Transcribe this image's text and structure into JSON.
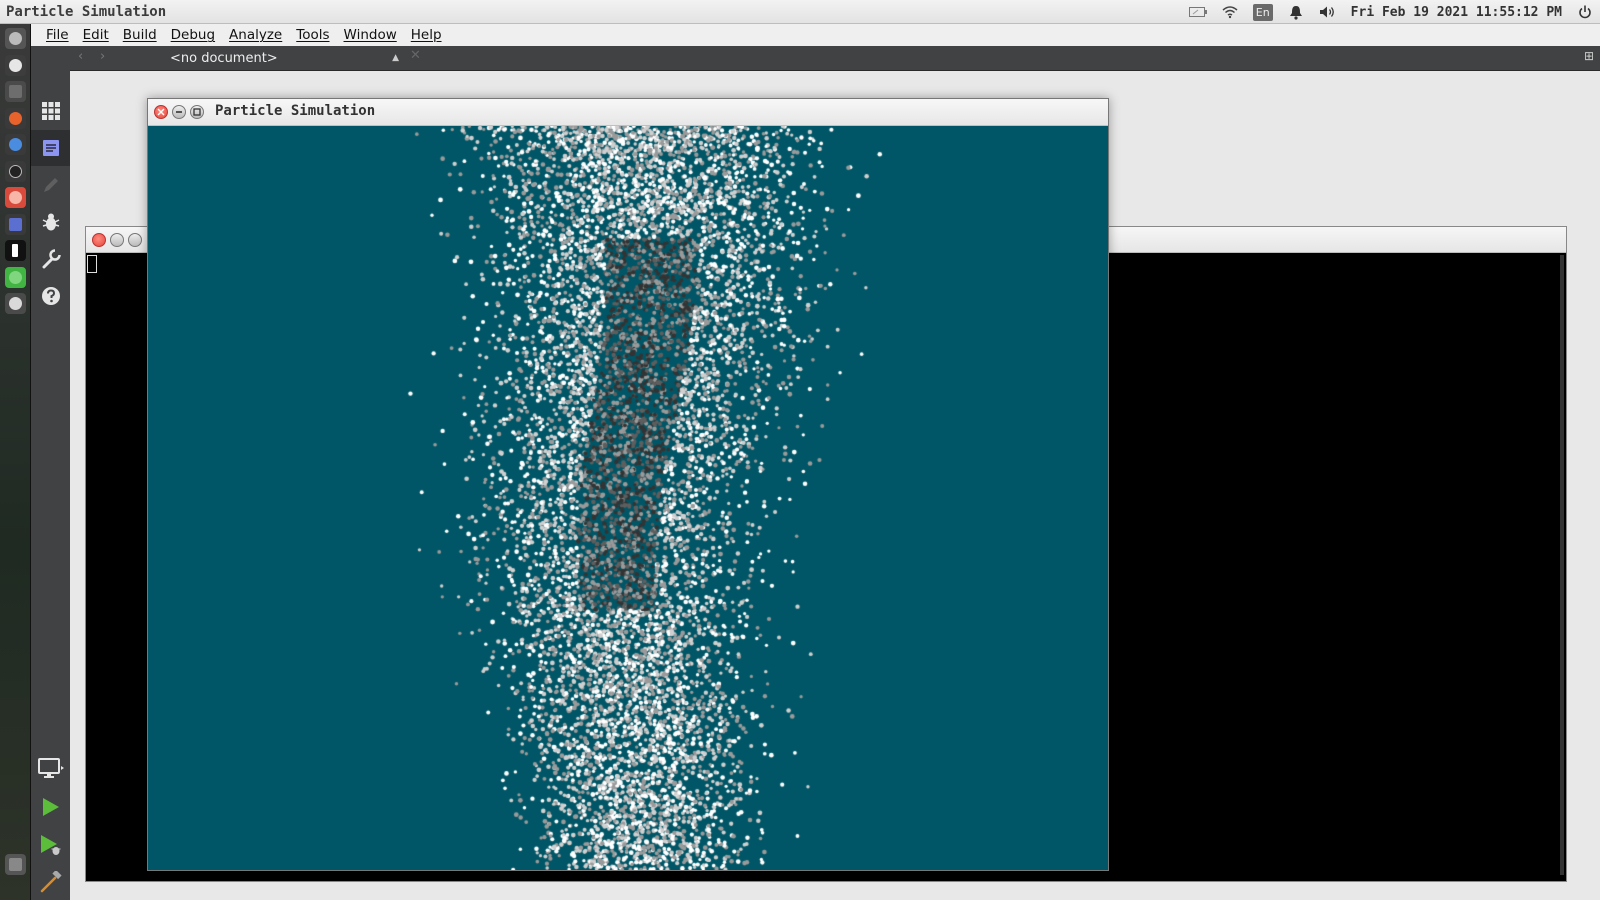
{
  "system_panel": {
    "app_title": "Particle Simulation",
    "language": "En",
    "clock": "Fri Feb 19 2021  11:55:12 PM",
    "icons": [
      "battery-icon",
      "wifi-icon",
      "bell-icon",
      "volume-icon",
      "power-icon"
    ]
  },
  "launcher": {
    "items": [
      "dash-icon",
      "settings-icon",
      "files-icon",
      "firefox-icon",
      "browser-icon",
      "terminal-icon",
      "app-red-icon",
      "app-blue-icon",
      "font-icon",
      "qt-icon",
      "system-settings-icon",
      "trash-icon"
    ]
  },
  "qt_creator": {
    "menus": [
      "File",
      "Edit",
      "Build",
      "Debug",
      "Analyze",
      "Tools",
      "Window",
      "Help"
    ],
    "document_selector": "<no document>",
    "modes": [
      "welcome-icon",
      "edit-icon",
      "design-icon",
      "debug-icon",
      "projects-icon",
      "help-icon"
    ],
    "run_controls": [
      "target-selector-icon",
      "run-icon",
      "debug-run-icon",
      "build-icon"
    ]
  },
  "particle_window": {
    "title": "Particle Simulation",
    "background_color": "#005666",
    "particle_colors": [
      "#ffffff",
      "#cfcfcf",
      "#9a9a9a",
      "#5e5e5e",
      "#333333"
    ]
  },
  "colors": {
    "panel_bg": "#e8e8e8",
    "qt_sidebar": "#404244",
    "console_bg": "#000000"
  }
}
